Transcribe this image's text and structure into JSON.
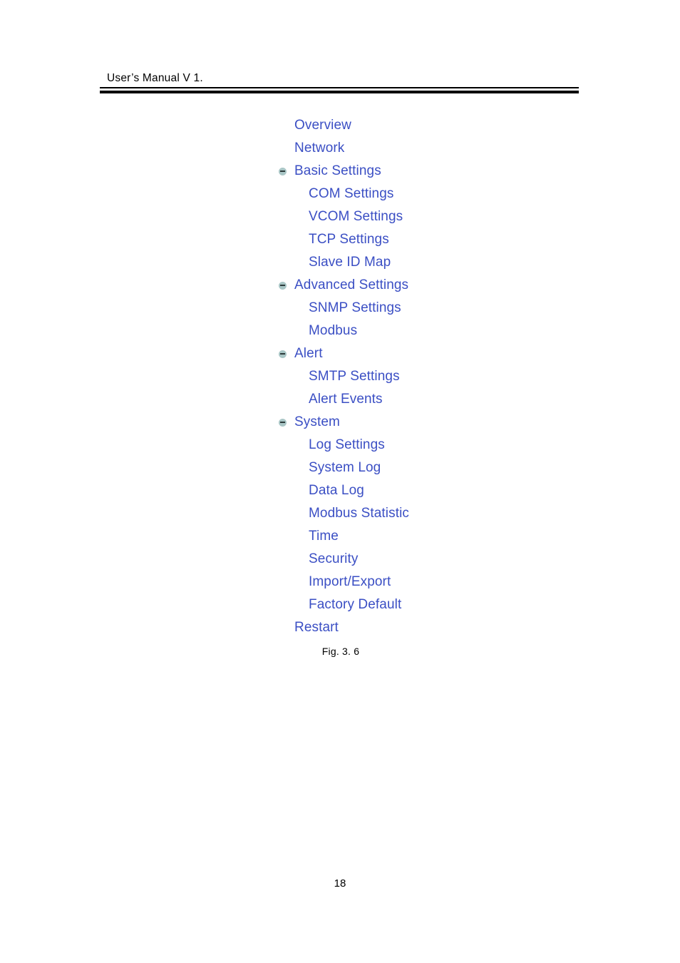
{
  "header": {
    "running_title": "User’s Manual V 1."
  },
  "figure": {
    "caption": "Fig. 3. 6",
    "node_icon_name": "collapse-node-icon",
    "link_color": "#3b4fc4",
    "node_icon_color": "#a9c6c6",
    "nav_tree": [
      {
        "label": "Overview",
        "level": 0,
        "has_icon": false
      },
      {
        "label": "Network",
        "level": 0,
        "has_icon": false
      },
      {
        "label": "Basic Settings",
        "level": 0,
        "has_icon": true
      },
      {
        "label": "COM Settings",
        "level": 1,
        "has_icon": false
      },
      {
        "label": "VCOM Settings",
        "level": 1,
        "has_icon": false
      },
      {
        "label": "TCP Settings",
        "level": 1,
        "has_icon": false
      },
      {
        "label": "Slave ID Map",
        "level": 1,
        "has_icon": false
      },
      {
        "label": "Advanced Settings",
        "level": 0,
        "has_icon": true
      },
      {
        "label": "SNMP Settings",
        "level": 1,
        "has_icon": false
      },
      {
        "label": "Modbus",
        "level": 1,
        "has_icon": false
      },
      {
        "label": "Alert",
        "level": 0,
        "has_icon": true
      },
      {
        "label": "SMTP Settings",
        "level": 1,
        "has_icon": false
      },
      {
        "label": "Alert Events",
        "level": 1,
        "has_icon": false
      },
      {
        "label": "System",
        "level": 0,
        "has_icon": true
      },
      {
        "label": "Log Settings",
        "level": 1,
        "has_icon": false
      },
      {
        "label": "System Log",
        "level": 1,
        "has_icon": false
      },
      {
        "label": "Data Log",
        "level": 1,
        "has_icon": false
      },
      {
        "label": "Modbus Statistic",
        "level": 1,
        "has_icon": false
      },
      {
        "label": "Time",
        "level": 1,
        "has_icon": false
      },
      {
        "label": "Security",
        "level": 1,
        "has_icon": false
      },
      {
        "label": "Import/Export",
        "level": 1,
        "has_icon": false
      },
      {
        "label": "Factory Default",
        "level": 1,
        "has_icon": false
      },
      {
        "label": "Restart",
        "level": 0,
        "has_icon": false
      }
    ]
  },
  "footer": {
    "page_number": "18"
  }
}
